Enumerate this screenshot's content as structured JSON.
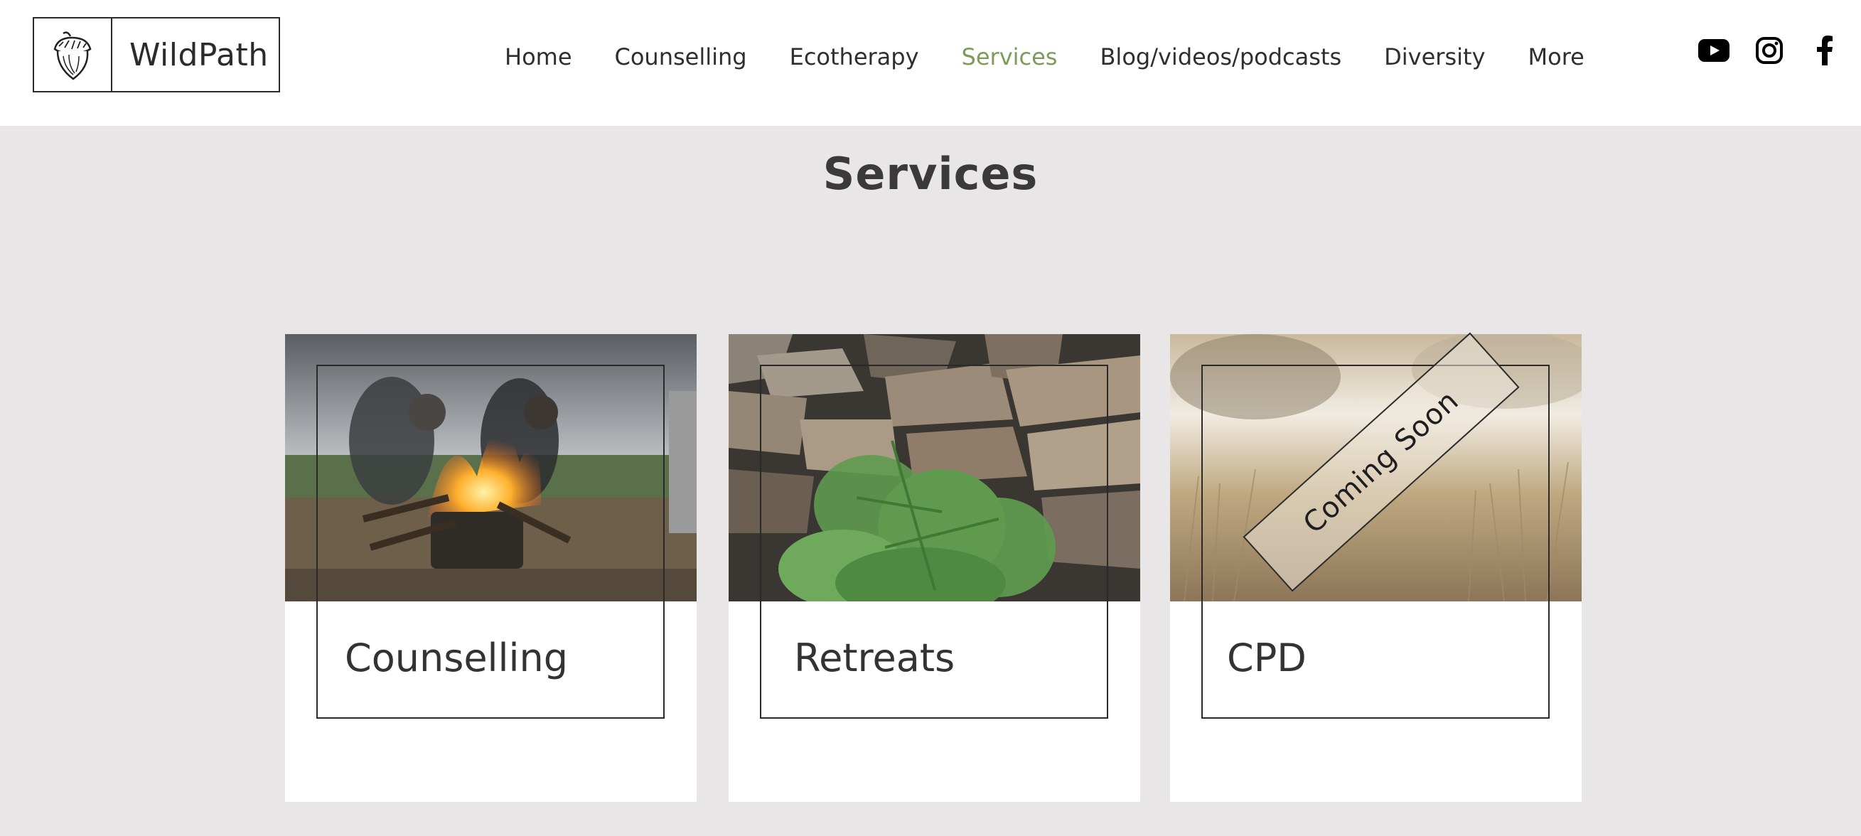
{
  "header": {
    "logo_text": "WildPath",
    "logo_icon": "acorn-icon",
    "nav": [
      {
        "label": "Home",
        "active": false
      },
      {
        "label": "Counselling",
        "active": false
      },
      {
        "label": "Ecotherapy",
        "active": false
      },
      {
        "label": "Services",
        "active": true
      },
      {
        "label": "Blog/videos/podcasts",
        "active": false
      },
      {
        "label": "Diversity",
        "active": false
      },
      {
        "label": "More",
        "active": false
      }
    ],
    "social": [
      "youtube-icon",
      "instagram-icon",
      "facebook-icon"
    ],
    "active_color": "#7d9c5a"
  },
  "main": {
    "title": "Services",
    "cards": [
      {
        "title": "Counselling",
        "image": "campfire-photo"
      },
      {
        "title": "Retreats",
        "image": "fern-woodpile-photo"
      },
      {
        "title": "CPD",
        "image": "grass-field-photo",
        "badge": "Coming Soon"
      }
    ]
  }
}
